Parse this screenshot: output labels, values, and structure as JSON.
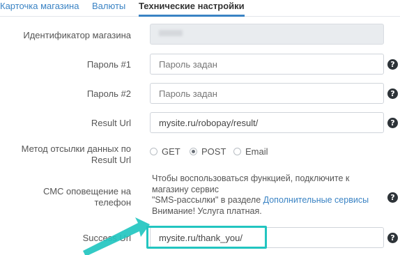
{
  "tabs": [
    {
      "label": "Карточка магазина",
      "active": false
    },
    {
      "label": "Валюты",
      "active": false
    },
    {
      "label": "Технические настройки",
      "active": true
    }
  ],
  "fields": {
    "shop_id": {
      "label": "Идентификатор магазина"
    },
    "password1": {
      "label": "Пароль #1",
      "placeholder": "Пароль задан"
    },
    "password2": {
      "label": "Пароль #2",
      "placeholder": "Пароль задан"
    },
    "result_url": {
      "label": "Result Url",
      "value": "mysite.ru/robopay/result/"
    },
    "send_method": {
      "label_line1": "Метод отсылки данных по",
      "label_line2": "Result Url",
      "options": [
        "GET",
        "POST",
        "Email"
      ],
      "selected": "POST"
    },
    "sms": {
      "label_line1": "СМС оповещение на",
      "label_line2": "телефон",
      "text_line1": "Чтобы воспользоваться функцией, подключите к",
      "text_line2": "магазину сервис",
      "text_line3_start": "\"SMS-рассылки\" в разделе ",
      "link": "Дополнительные сервисы",
      "text_line4": "Внимание! Услуга платная."
    },
    "success_url": {
      "label": "Success Url",
      "value": "mysite.ru/thank_you/"
    }
  },
  "help_icon_glyph": "?",
  "colors": {
    "accent": "#3a83c4",
    "highlight": "#22c5c0",
    "help_icon": "#2d3338"
  }
}
